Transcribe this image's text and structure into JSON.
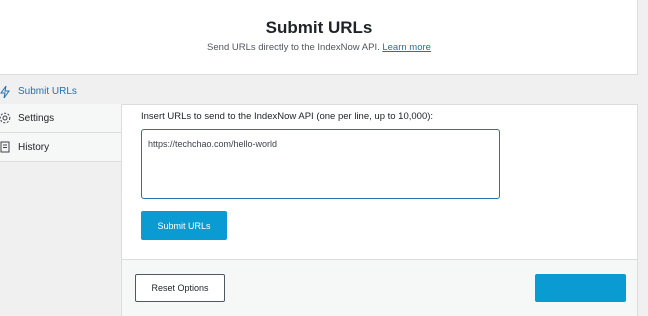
{
  "header": {
    "title": "Submit URLs",
    "subtitle": "Send URLs directly to the IndexNow API.",
    "learn_more": "Learn more"
  },
  "nav": {
    "items": [
      {
        "label": "Submit URLs",
        "icon": "lightning-icon"
      },
      {
        "label": "Settings",
        "icon": "gear-icon"
      },
      {
        "label": "History",
        "icon": "history-icon"
      }
    ]
  },
  "form": {
    "label": "Insert URLs to send to the IndexNow API (one per line, up to 10,000):",
    "value": "https://techchao.com/hello-world",
    "submit_label": "Submit URLs"
  },
  "footer": {
    "reset_label": "Reset Options",
    "save_label": ""
  },
  "colors": {
    "accent": "#2271b1",
    "button": "#0a9bd3",
    "background": "#f0f0f1"
  }
}
